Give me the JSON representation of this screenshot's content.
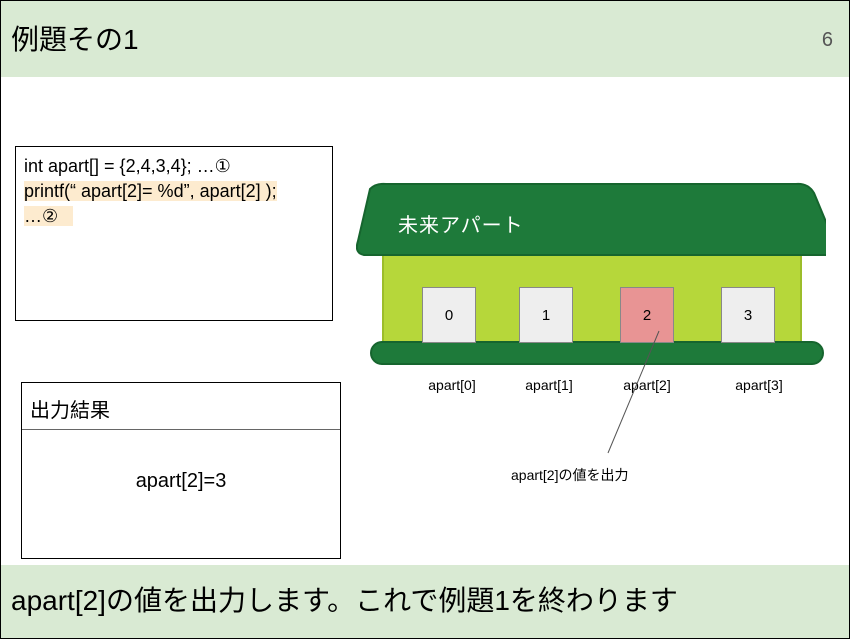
{
  "header": {
    "title": "例題その1",
    "page_number": "6"
  },
  "code": {
    "line1": "int apart[] = {2,4,3,4}; …①",
    "line2": "printf(“ apart[2]= %d”, apart[2] );",
    "line3": "…②"
  },
  "output": {
    "heading": "出力結果",
    "value": "apart[2]=3"
  },
  "apartment": {
    "name": "未来アパート",
    "doors": [
      "0",
      "1",
      "2",
      "3"
    ],
    "labels": [
      "apart[0]",
      "apart[1]",
      "apart[2]",
      "apart[3]"
    ],
    "highlight_color": "#e89494",
    "roof_color": "#1e7a3a",
    "wall_color": "#b6d73a"
  },
  "annotation": "apart[2]の値を出力",
  "footer": {
    "caption": "apart[2]の値を出力します。これで例題1を終わります"
  }
}
